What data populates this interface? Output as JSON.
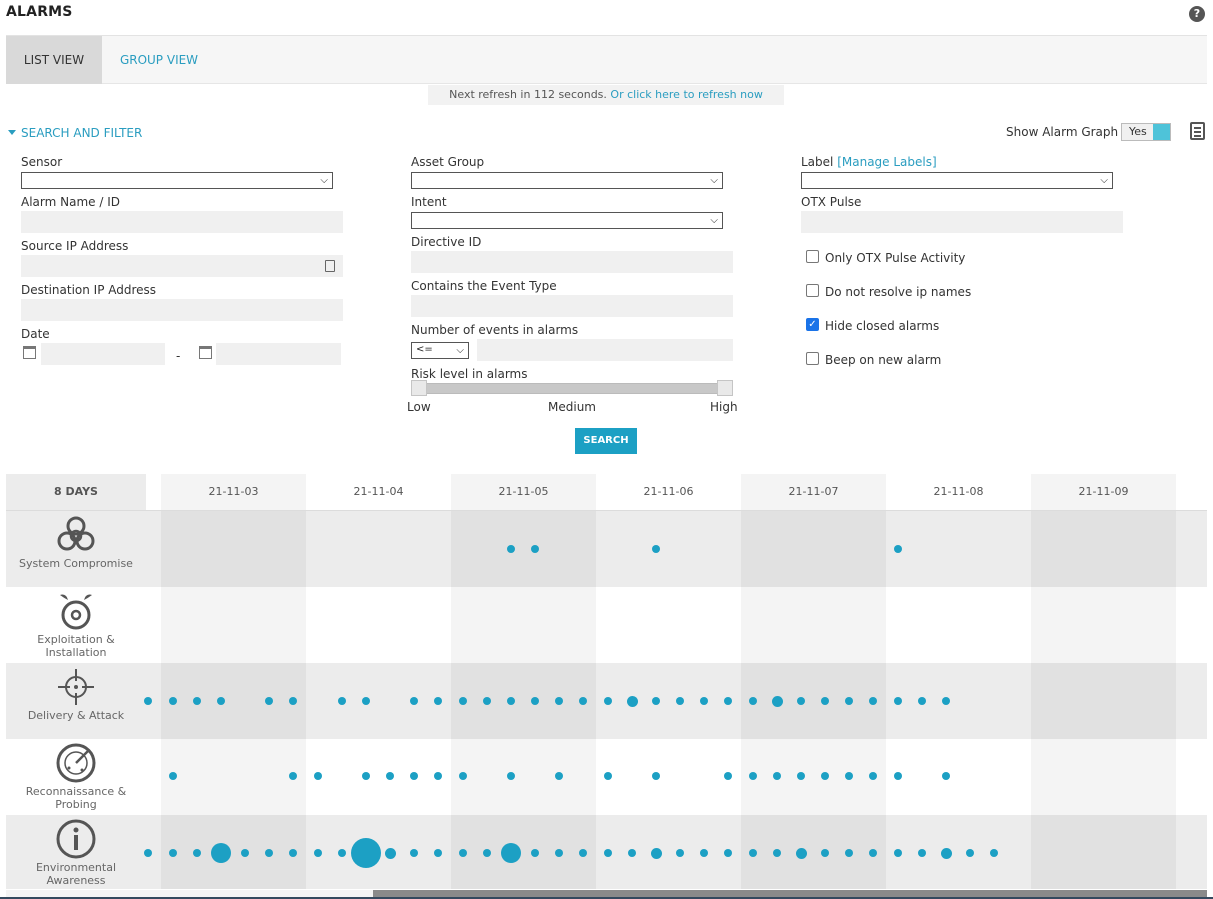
{
  "page": {
    "title": "ALARMS"
  },
  "tabs": [
    {
      "label": "LIST VIEW"
    },
    {
      "label": "GROUP VIEW"
    }
  ],
  "refresh": {
    "text": "Next refresh in 112 seconds.",
    "link": "Or click here to refresh now"
  },
  "filter": {
    "toggle_label": "SEARCH AND FILTER",
    "show_graph_label": "Show Alarm Graph",
    "show_graph_value": "Yes",
    "sensor": "Sensor",
    "alarm_name": "Alarm Name / ID",
    "source_ip": "Source IP Address",
    "dest_ip": "Destination IP Address",
    "date": "Date",
    "date_sep": "-",
    "asset_group": "Asset Group",
    "intent": "Intent",
    "directive_id": "Directive ID",
    "event_type": "Contains the Event Type",
    "num_events": "Number of events in alarms",
    "num_events_op": "<=",
    "risk_level": "Risk level in alarms",
    "risk_low": "Low",
    "risk_medium": "Medium",
    "risk_high": "High",
    "label": "Label",
    "manage_labels": "[Manage Labels]",
    "otx_pulse": "OTX Pulse",
    "chk_otx": "Only OTX Pulse Activity",
    "chk_resolve": "Do not resolve ip names",
    "chk_hide": "Hide closed alarms",
    "chk_beep": "Beep on new alarm",
    "chk_hide_checked": true,
    "search_button": "SEARCH"
  },
  "graph": {
    "days_label": "8 DAYS",
    "dates": [
      "21-11-03",
      "21-11-04",
      "21-11-05",
      "21-11-06",
      "21-11-07",
      "21-11-08",
      "21-11-09"
    ],
    "rows": [
      {
        "label_lines": [
          "System Compromise"
        ],
        "icon": "biohazard-icon"
      },
      {
        "label_lines": [
          "Exploitation &",
          "Installation"
        ],
        "icon": "bomb-icon"
      },
      {
        "label_lines": [
          "Delivery & Attack"
        ],
        "icon": "crosshair-icon"
      },
      {
        "label_lines": [
          "Reconnaissance &",
          "Probing"
        ],
        "icon": "radar-icon"
      },
      {
        "label_lines": [
          "Environmental",
          "Awareness"
        ],
        "icon": "info-icon"
      }
    ],
    "accent": "#1ca0c4"
  }
}
